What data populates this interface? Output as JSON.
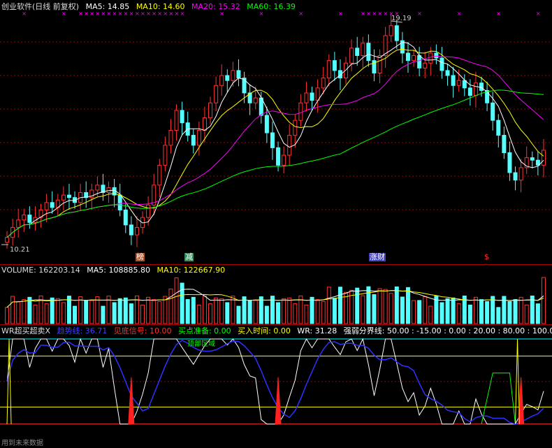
{
  "main_header": {
    "title": "创业软件(日线 前复权)",
    "ma5": "MA5: 14.85",
    "ma10": "MA10: 14.60",
    "ma20": "MA20: 15.32",
    "ma60": "MA60: 16.39"
  },
  "price_labels": {
    "high": "19.19",
    "low": "10.21"
  },
  "signal_tags": {
    "bang": "榜",
    "jian": "减",
    "zhang_cai": "涨财",
    "dollar": "$"
  },
  "volume_header": {
    "volume": "VOLUME: 162203.14",
    "ma5": "MA5: 108885.80",
    "ma10": "MA10: 122667.90"
  },
  "wr_header": {
    "name": "WR超买超卖X",
    "trend": "趋势线: 36.71",
    "bottom": "见底信号: 10.00",
    "buy_ready": "买点准备: 0.00",
    "buy_time": "买入时间: 0.00",
    "wr": "WR: 31.28",
    "bounds": "强弱分界线: 50.00 : -15.00 : 0.00 : 20.00 : 80.00 : 100.00"
  },
  "wr_labels": {
    "top_zone": "顶部区域",
    "footer": "用到未来数据"
  },
  "colors": {
    "up": "#ff3232",
    "down": "#54ffff",
    "ma5": "#ffffff",
    "ma10": "#ffff00",
    "ma20": "#ff00ff",
    "ma60": "#00ff00",
    "grid": "#a00000"
  },
  "chart_data": {
    "type": "candlestick",
    "price_range": [
      10.21,
      19.19
    ],
    "closes": [
      10.5,
      10.9,
      11.2,
      11.4,
      11.1,
      11.3,
      11.6,
      11.9,
      11.7,
      12.0,
      12.2,
      12.1,
      11.9,
      12.3,
      12.1,
      12.4,
      12.6,
      12.3,
      12.5,
      12.2,
      11.6,
      11.0,
      10.6,
      10.9,
      11.3,
      11.8,
      12.6,
      13.4,
      14.2,
      14.8,
      15.6,
      15.1,
      14.6,
      14.2,
      14.8,
      15.3,
      15.9,
      16.6,
      17.0,
      16.8,
      17.2,
      16.9,
      16.3,
      15.9,
      16.1,
      15.4,
      14.7,
      14.1,
      13.4,
      13.8,
      14.6,
      15.2,
      15.9,
      16.3,
      16.0,
      16.5,
      16.9,
      17.6,
      17.2,
      16.9,
      17.5,
      18.1,
      17.8,
      18.3,
      17.6,
      17.1,
      17.8,
      18.6,
      19.0,
      18.4,
      17.9,
      17.6,
      17.8,
      17.3,
      17.5,
      17.9,
      17.7,
      17.2,
      17.0,
      16.6,
      16.8,
      16.5,
      16.2,
      16.7,
      16.4,
      15.9,
      15.2,
      14.6,
      13.9,
      13.1,
      12.8,
      13.3,
      13.7,
      13.6,
      13.4,
      14.0
    ],
    "volume_range": [
      0,
      162203.14
    ],
    "wr_range": [
      -15,
      100
    ]
  }
}
